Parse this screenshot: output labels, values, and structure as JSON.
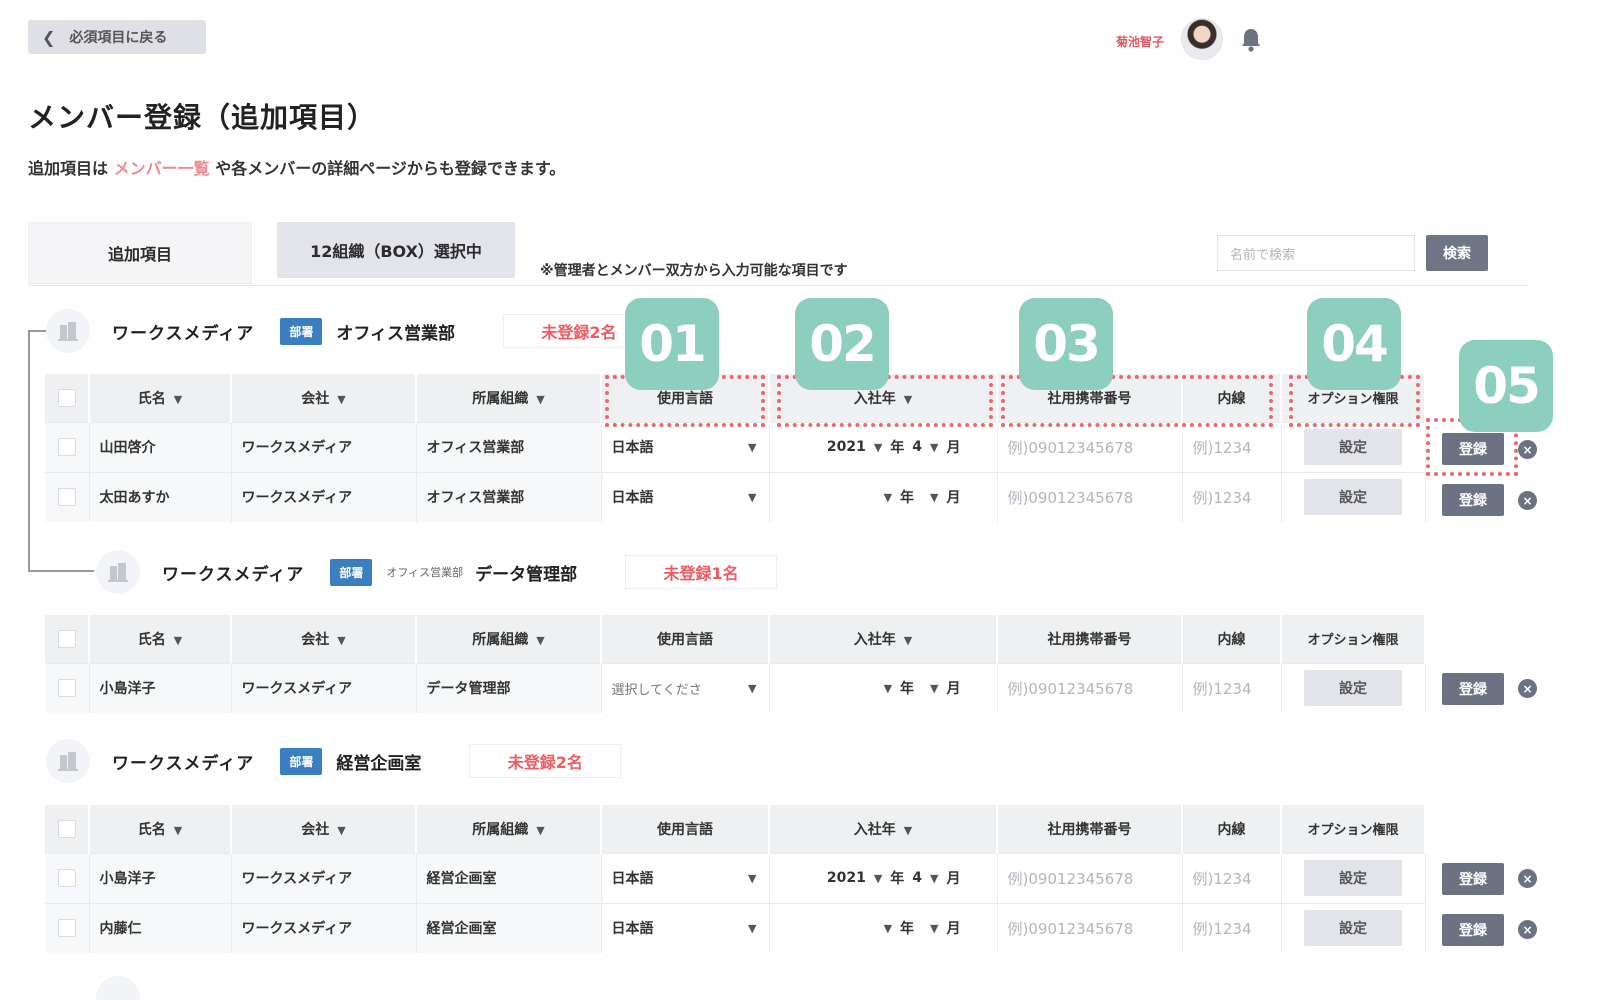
{
  "header": {
    "back_label": "必須項目に戻る",
    "user_name": "菊池智子"
  },
  "page": {
    "title": "メンバー登録（追加項目）",
    "desc_prefix": "追加項目は",
    "desc_link": "メンバー一覧",
    "desc_suffix": "や各メンバーの詳細ページからも登録できます。"
  },
  "tabs": {
    "tab1": "追加項目",
    "tab2": "12組織（BOX）選択中",
    "note": "※管理者とメンバー双方から入力可能な項目です"
  },
  "search": {
    "placeholder": "名前で検索",
    "button": "検索"
  },
  "columns": [
    "氏名",
    "会社",
    "所属組織",
    "使用言語",
    "入社年",
    "社用携帯番号",
    "内線",
    "オプション権限"
  ],
  "date_units": {
    "year": "年",
    "month": "月"
  },
  "buttons": {
    "settings": "設定",
    "register": "登録",
    "delete": "×"
  },
  "placeholders": {
    "phone": "例)09012345678",
    "ext": "例)1234"
  },
  "groups": [
    {
      "company": "ワークスメディア",
      "badge": "部署",
      "parent_dept": "",
      "dept": "オフィス営業部",
      "unregistered": "未登録2名",
      "rows": [
        {
          "name": "山田啓介",
          "company": "ワークスメディア",
          "org": "オフィス営業部",
          "lang": "日本語",
          "year": "2021",
          "month": "4"
        },
        {
          "name": "太田あすか",
          "company": "ワークスメディア",
          "org": "オフィス営業部",
          "lang": "日本語",
          "year": "",
          "month": ""
        }
      ]
    },
    {
      "company": "ワークスメディア",
      "badge": "部署",
      "parent_dept": "オフィス営業部",
      "dept": "データ管理部",
      "unregistered": "未登録1名",
      "rows": [
        {
          "name": "小島洋子",
          "company": "ワークスメディア",
          "org": "データ管理部",
          "lang": "選択してくださ",
          "year": "",
          "month": ""
        }
      ]
    },
    {
      "company": "ワークスメディア",
      "badge": "部署",
      "parent_dept": "",
      "dept": "経営企画室",
      "unregistered": "未登録2名",
      "rows": [
        {
          "name": "小島洋子",
          "company": "ワークスメディア",
          "org": "経営企画室",
          "lang": "日本語",
          "year": "2021",
          "month": "4"
        },
        {
          "name": "内藤仁",
          "company": "ワークスメディア",
          "org": "経営企画室",
          "lang": "日本語",
          "year": "",
          "month": ""
        }
      ]
    }
  ],
  "callouts": [
    "01",
    "02",
    "03",
    "04",
    "05"
  ],
  "colors": {
    "callout": "#8ccfbf",
    "highlight": "#e86a6e",
    "badge": "#3b7fc0",
    "unregistered": "#ef5b61",
    "button": "#6d7282"
  }
}
